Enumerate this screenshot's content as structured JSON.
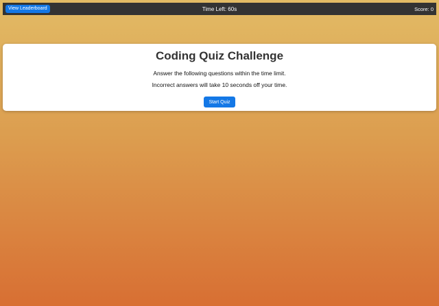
{
  "header": {
    "leaderboard_label": "View Leaderboard",
    "timer_text": "Time Left: 60s",
    "score_text": "Score: 0"
  },
  "intro": {
    "title": "Coding Quiz Challenge",
    "line1": "Answer the following questions within the time limit.",
    "line2": "Incorrect answers will take 10 seconds off your time.",
    "start_label": "Start Quiz"
  },
  "colors": {
    "header_bg": "#333333",
    "button_bg": "#1478e6",
    "gradient_top": "#e2bb65",
    "gradient_bottom": "#d86f33"
  }
}
